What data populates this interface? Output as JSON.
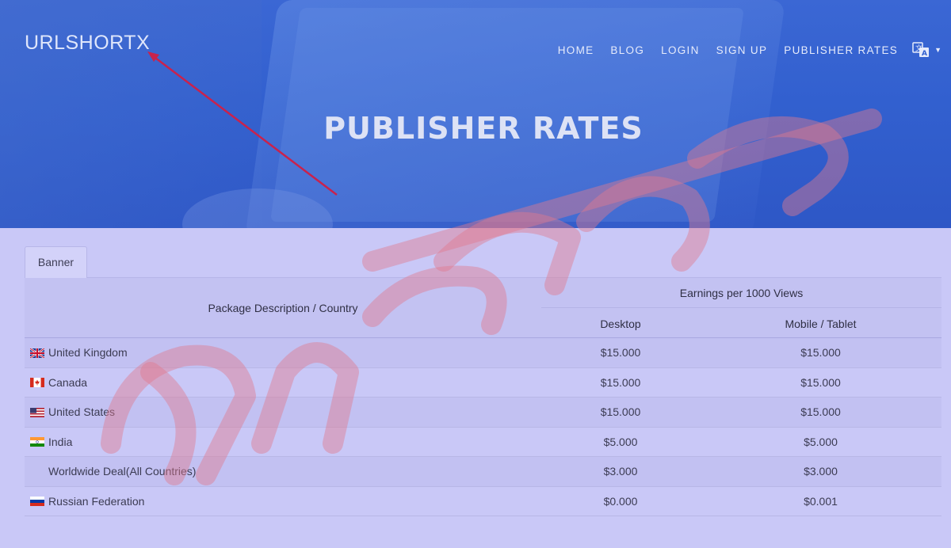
{
  "header": {
    "logo": "URLSHORTX",
    "nav": [
      "HOME",
      "BLOG",
      "LOGIN",
      "SIGN UP",
      "PUBLISHER RATES"
    ],
    "language_icon": "translate-icon",
    "title": "PUBLISHER RATES"
  },
  "tabs": [
    "Banner"
  ],
  "table": {
    "col_package": "Package Description / Country",
    "col_earnings": "Earnings per 1000 Views",
    "col_desktop": "Desktop",
    "col_mobile": "Mobile / Tablet",
    "rows": [
      {
        "flag": "uk-flag",
        "country": "United Kingdom",
        "desktop": "$15.000",
        "mobile": "$15.000"
      },
      {
        "flag": "canada-flag",
        "country": "Canada",
        "desktop": "$15.000",
        "mobile": "$15.000"
      },
      {
        "flag": "us-flag",
        "country": "United States",
        "desktop": "$15.000",
        "mobile": "$15.000"
      },
      {
        "flag": "india-flag",
        "country": "India",
        "desktop": "$5.000",
        "mobile": "$5.000"
      },
      {
        "flag": "",
        "country": "Worldwide Deal(All Countries)",
        "desktop": "$3.000",
        "mobile": "$3.000"
      },
      {
        "flag": "russia-flag",
        "country": "Russian Federation",
        "desktop": "$0.000",
        "mobile": "$0.001"
      }
    ]
  },
  "colors": {
    "hero": "#3260cf",
    "page_bg": "#c9c8f7",
    "arrow": "#c9224d",
    "watermark": "#e07a8e"
  }
}
